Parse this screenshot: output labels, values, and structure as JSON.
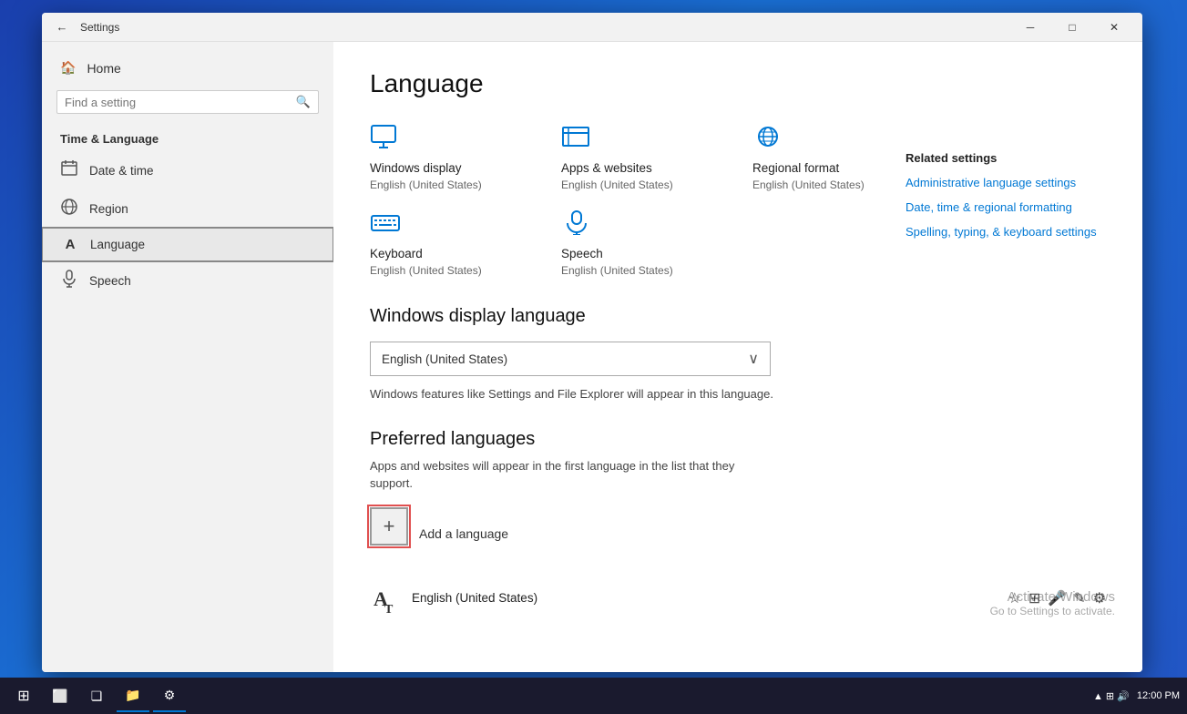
{
  "titlebar": {
    "title": "Settings",
    "back_label": "←",
    "minimize": "─",
    "maximize": "□",
    "close": "✕"
  },
  "sidebar": {
    "home_label": "Home",
    "search_placeholder": "Find a setting",
    "category": "Time & Language",
    "items": [
      {
        "id": "date-time",
        "label": "Date & time",
        "icon": "📅"
      },
      {
        "id": "region",
        "label": "Region",
        "icon": "🌐"
      },
      {
        "id": "language",
        "label": "Language",
        "icon": "A"
      },
      {
        "id": "speech",
        "label": "Speech",
        "icon": "🎤"
      }
    ]
  },
  "content": {
    "title": "Language",
    "icon_cards": [
      {
        "id": "windows-display",
        "title": "Windows display",
        "subtitle": "English (United States)",
        "icon_type": "monitor"
      },
      {
        "id": "apps-websites",
        "title": "Apps & websites",
        "subtitle": "English (United States)",
        "icon_type": "window"
      },
      {
        "id": "regional-format",
        "title": "Regional format",
        "subtitle": "English (United States)",
        "icon_type": "globe"
      },
      {
        "id": "keyboard",
        "title": "Keyboard",
        "subtitle": "English (United States)",
        "icon_type": "keyboard"
      },
      {
        "id": "speech",
        "title": "Speech",
        "subtitle": "English (United States)",
        "icon_type": "mic"
      }
    ],
    "windows_display_language_section": "Windows display language",
    "dropdown_value": "English (United States)",
    "dropdown_desc": "Windows features like Settings and File Explorer will appear in this language.",
    "preferred_languages_section": "Preferred languages",
    "preferred_desc": "Apps and websites will appear in the first language in the list that they support.",
    "add_language_label": "Add a language",
    "language_entry": {
      "name": "English (United States)",
      "icon": "A"
    }
  },
  "related_settings": {
    "title": "Related settings",
    "links": [
      "Administrative language settings",
      "Date, time & regional formatting",
      "Spelling, typing, & keyboard settings"
    ]
  },
  "activate_watermark": {
    "line1": "Activate Windows",
    "line2": "Go to Settings to activate."
  },
  "taskbar": {
    "time": "12:00",
    "date": "PM"
  }
}
